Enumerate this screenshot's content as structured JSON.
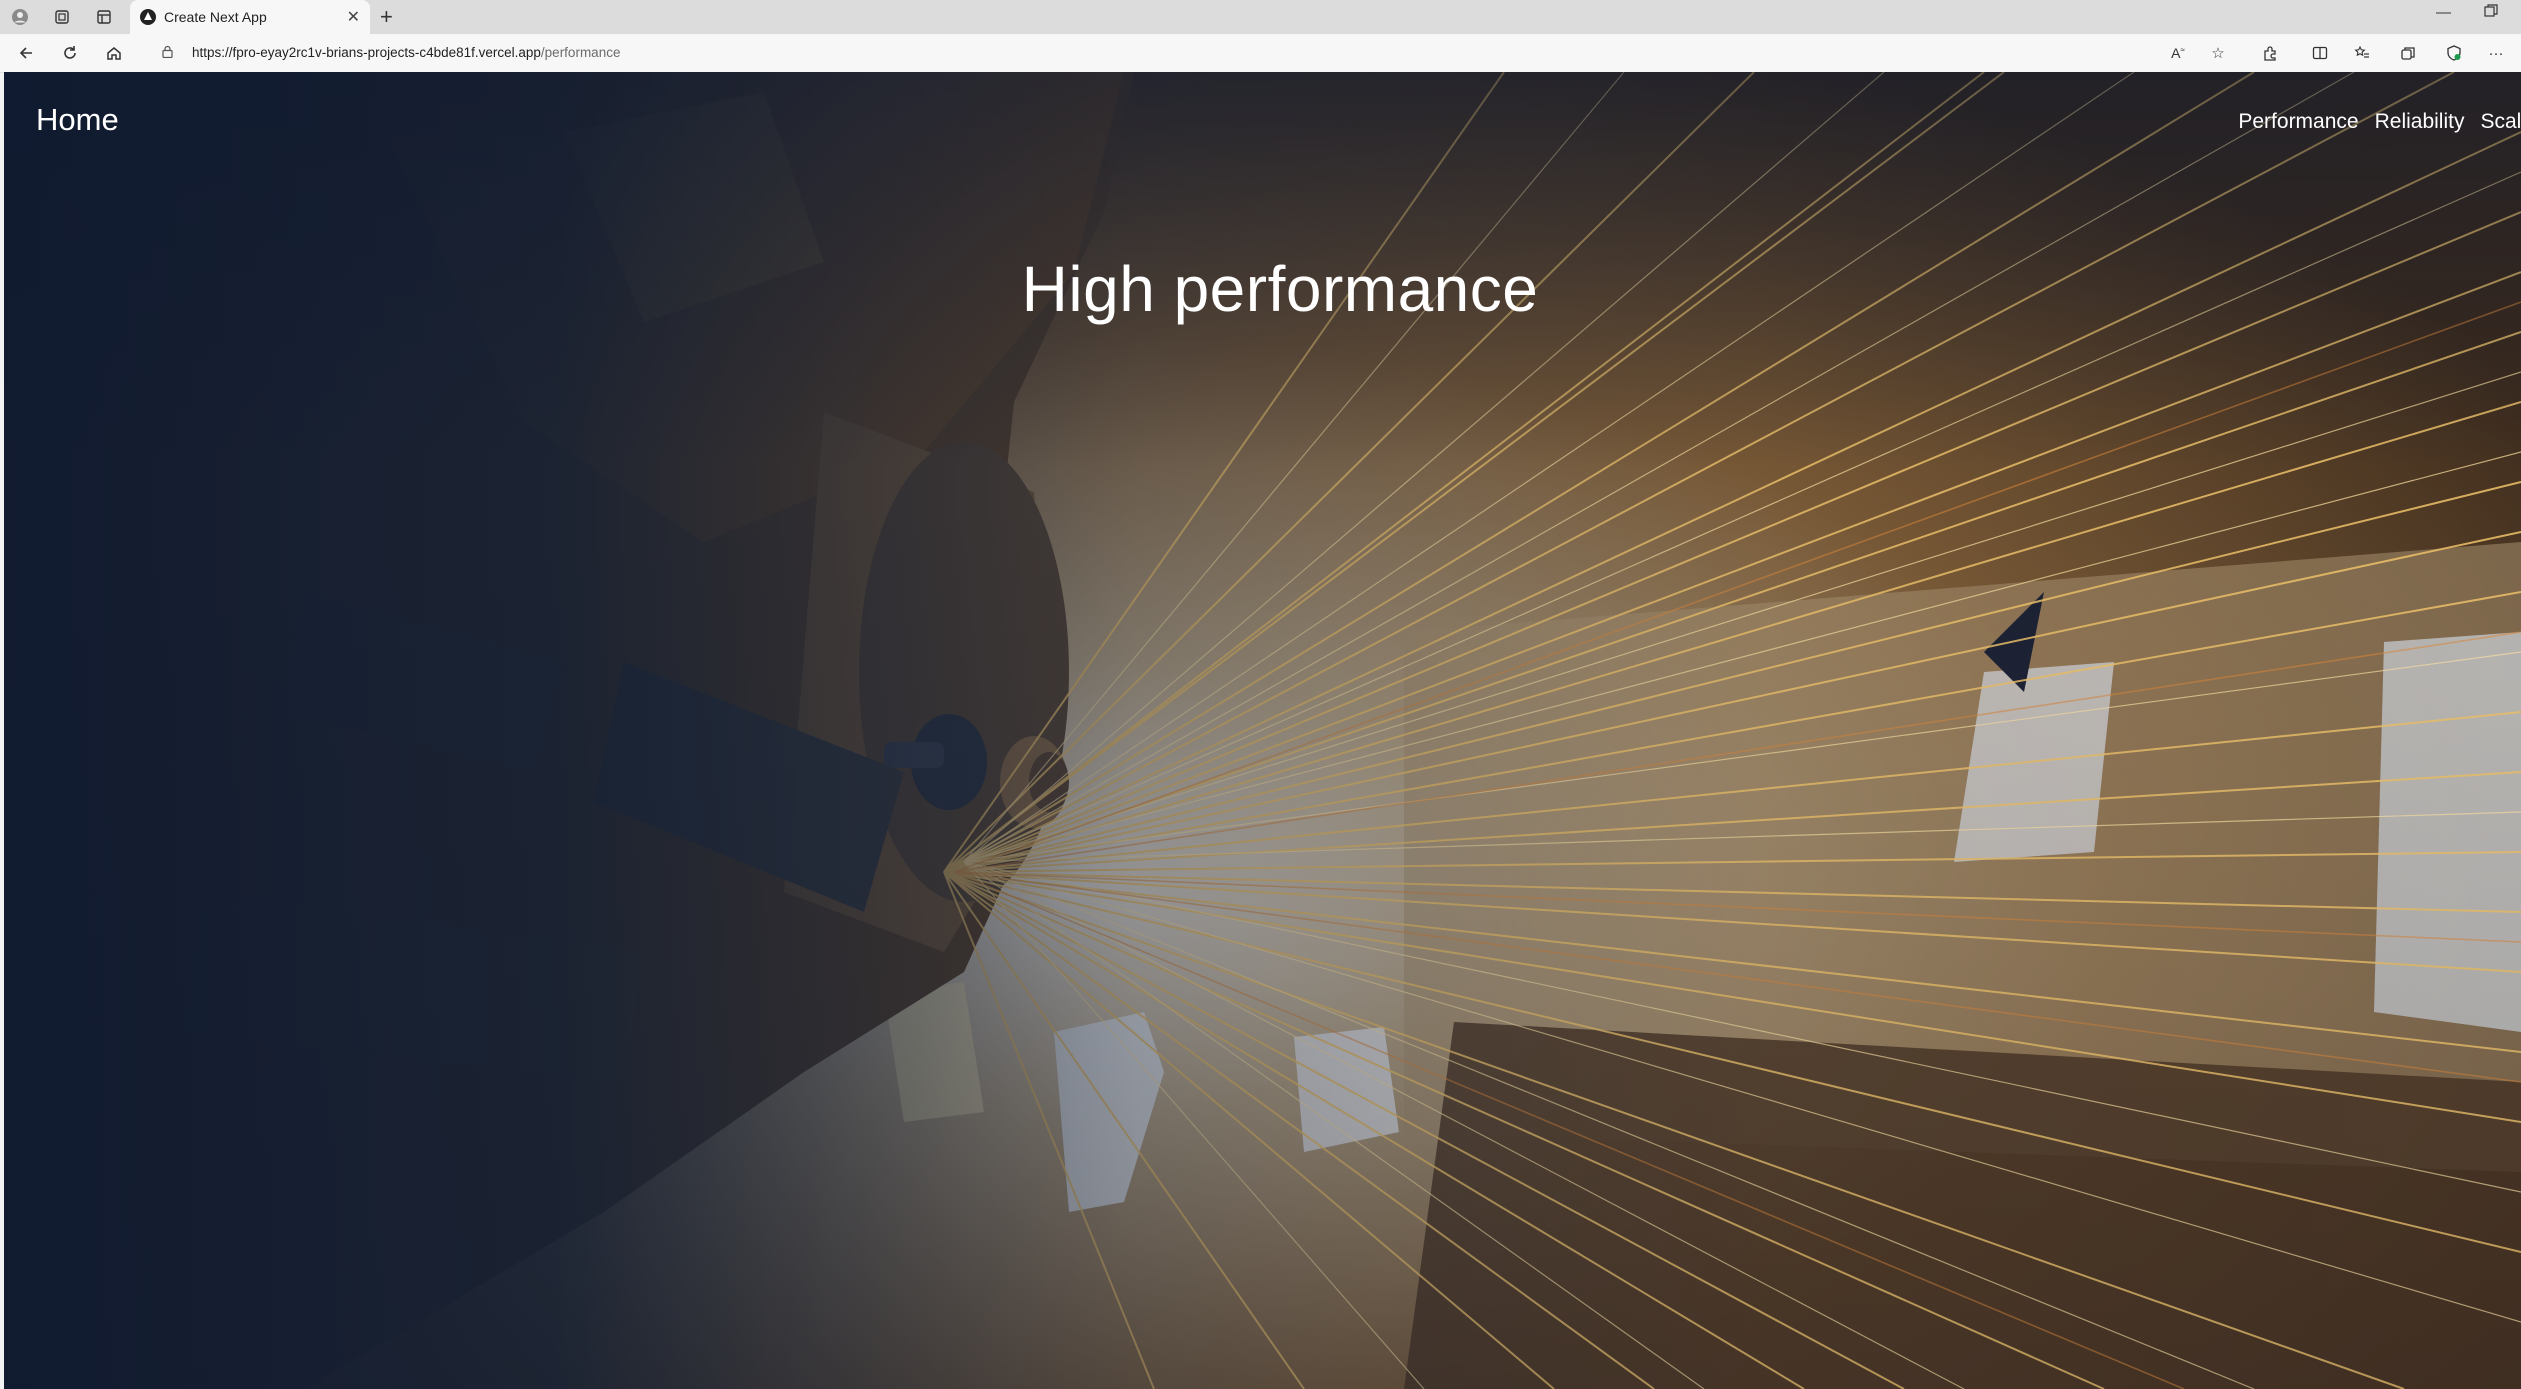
{
  "browser": {
    "tab_title": "Create Next App",
    "url_host": "https://fpro-eyay2rc1v-brians-projects-c4bde81f.vercel.app",
    "url_path": "/performance",
    "icons": [
      "profile-icon",
      "workspaces-icon",
      "tab-actions-icon",
      "favicon-icon",
      "close-icon",
      "new-tab-icon",
      "minimize-icon",
      "restore-icon",
      "back-icon",
      "refresh-icon",
      "home-icon",
      "lock-icon",
      "read-aloud-icon",
      "favorite-star-icon",
      "extensions-icon",
      "split-screen-icon",
      "favorites-icon",
      "collections-icon",
      "browser-essentials-icon",
      "more-icon"
    ]
  },
  "site": {
    "home_label": "Home",
    "nav": [
      {
        "label": "Performance"
      },
      {
        "label": "Reliability"
      },
      {
        "label": "Scale"
      }
    ],
    "hero_title": "High performance"
  },
  "colors": {
    "overlay_left": "#0f1a30",
    "sparks": "#f0b75a",
    "text": "#ffffff"
  }
}
